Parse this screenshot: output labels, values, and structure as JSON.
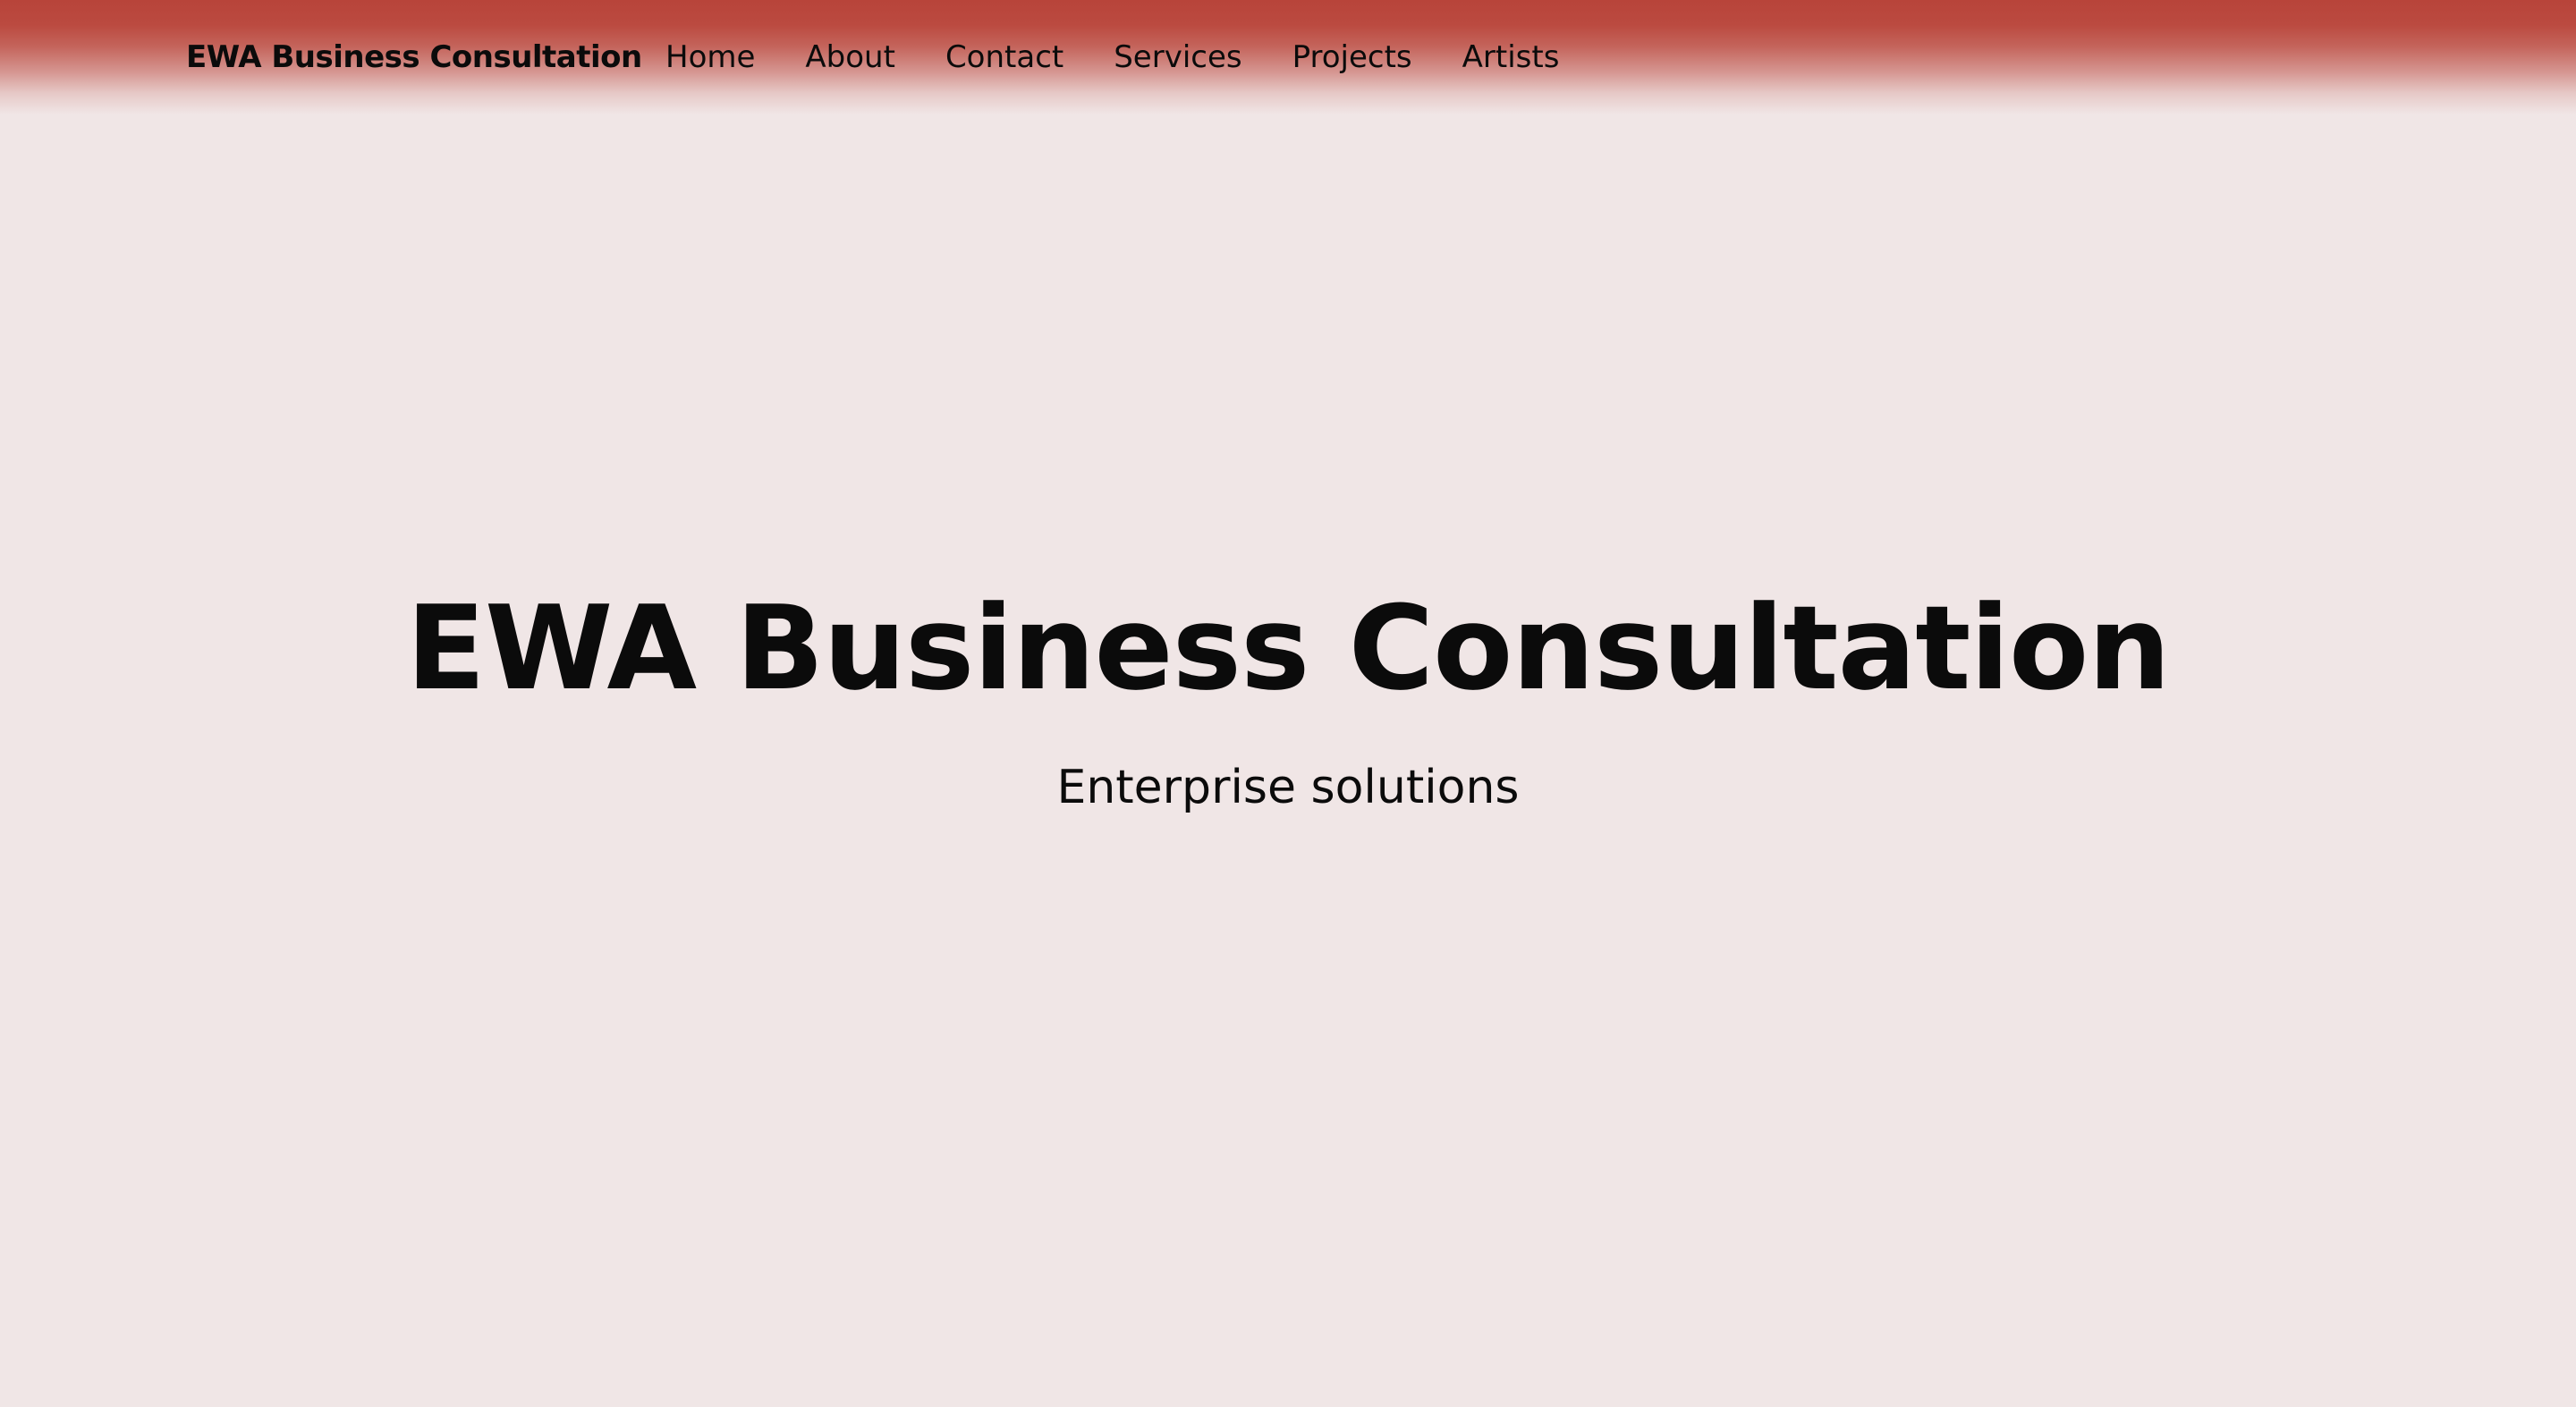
{
  "header": {
    "brand": "EWA Business Consultation",
    "nav": [
      {
        "label": "Home"
      },
      {
        "label": "About"
      },
      {
        "label": "Contact"
      },
      {
        "label": "Services"
      },
      {
        "label": "Projects"
      },
      {
        "label": "Artists"
      }
    ]
  },
  "hero": {
    "title": "EWA Business Consultation",
    "subtitle": "Enterprise solutions"
  },
  "colors": {
    "header_red": "#b8443a",
    "page_background": "#f0e6e6",
    "text": "#0b0b0b"
  }
}
